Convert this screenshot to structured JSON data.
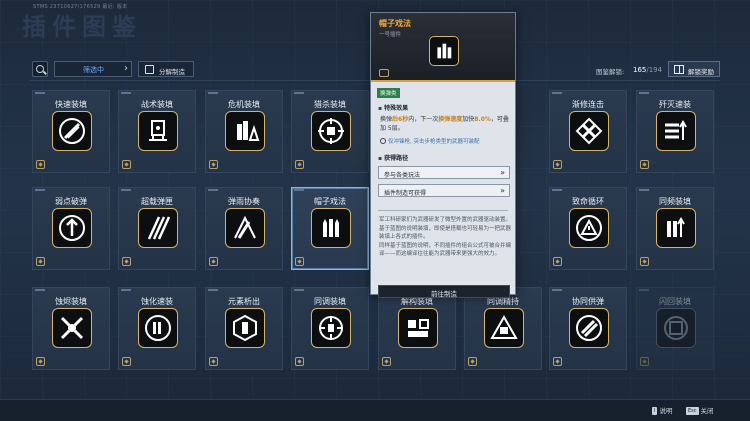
{
  "header": {
    "title": "插件图鉴",
    "info": "STMS  23710627/176529   最近:  版本"
  },
  "toolbar": {
    "filter_label": "筛选中",
    "decompose_label": "分解制造",
    "progress_label": "图鉴解锁:",
    "progress_value": "165",
    "progress_total": "/194",
    "unlock_reward_label": "解锁奖励"
  },
  "cards": [
    {
      "title": "快速装填",
      "icon": "reload-rings-icon"
    },
    {
      "title": "战术装填",
      "icon": "tactical-reload-icon"
    },
    {
      "title": "危机装填",
      "icon": "crisis-reload-icon"
    },
    {
      "title": "猎杀装填",
      "icon": "hunt-reload-icon"
    },
    {
      "title": "歼灭速装",
      "icon": "annihilate-reload-icon"
    },
    {
      "title": "渐修连击",
      "icon": "combo-icon"
    },
    {
      "title": "歼灭速装",
      "icon": "rapid-load-icon"
    },
    {
      "title": "弱点破弹",
      "icon": "weakpoint-icon"
    },
    {
      "title": "超载弹匣",
      "icon": "overload-mag-icon"
    },
    {
      "title": "弹雨协奏",
      "icon": "bullet-rain-icon"
    },
    {
      "title": "帽子戏法",
      "icon": "hat-trick-icon"
    },
    {
      "title": "致命循环",
      "icon": "lethal-cycle-icon"
    },
    {
      "title": "同频装填",
      "icon": "sync-reload-icon"
    },
    {
      "title": "蚀烬装填",
      "icon": "erosion-icon"
    },
    {
      "title": "蚀化速装",
      "icon": "corrode-icon"
    },
    {
      "title": "元素析出",
      "icon": "element-icon"
    },
    {
      "title": "同调装填",
      "icon": "tune-reload-icon"
    },
    {
      "title": "解构装填",
      "icon": "deconstruct-icon"
    },
    {
      "title": "同调精持",
      "icon": "tune-hold-icon"
    },
    {
      "title": "协同供弹",
      "icon": "co-feed-icon"
    },
    {
      "title": "闪回装填",
      "icon": "flashback-icon"
    }
  ],
  "popup": {
    "title": "帽子戏法",
    "subtitle": "一号插件",
    "tag": "换弹类",
    "effect_heading": "特殊效果",
    "effect_pre": "换弹",
    "effect_hl1": "后6秒",
    "effect_mid": "内，下一次",
    "effect_hl2": "换弹速度",
    "effect_mid2": "加快",
    "effect_hl3": "8.0%",
    "effect_post": "，可叠加 5层。",
    "compat_text": "仅冲锋枪, 突击步枪类型的武器可装配",
    "source_heading": "获得路径",
    "source_1": "参与各类玩法",
    "source_2": "插件制造可获得",
    "description": "军工科研家们为武器研发了微型外置的武器驱动装置。\n基于蓝图的说明装填，即使是搭载也可轻易为一把武器装填上各式的插件。\n同样基于蓝图的说明，不同插件的组合公式可被合并编译——而这编译往往能为武器带来更强大的效力。",
    "goto_label": "前往制造"
  },
  "bottom": {
    "help_key": "I",
    "help_label": "说明",
    "close_key": "Esc",
    "close_label": "关闭"
  },
  "colors": {
    "accent_gold": "#d3b46a",
    "title_orange": "#f0a83a",
    "filter_blue": "#6ea9ff",
    "tag_green": "#2e7d4a"
  }
}
